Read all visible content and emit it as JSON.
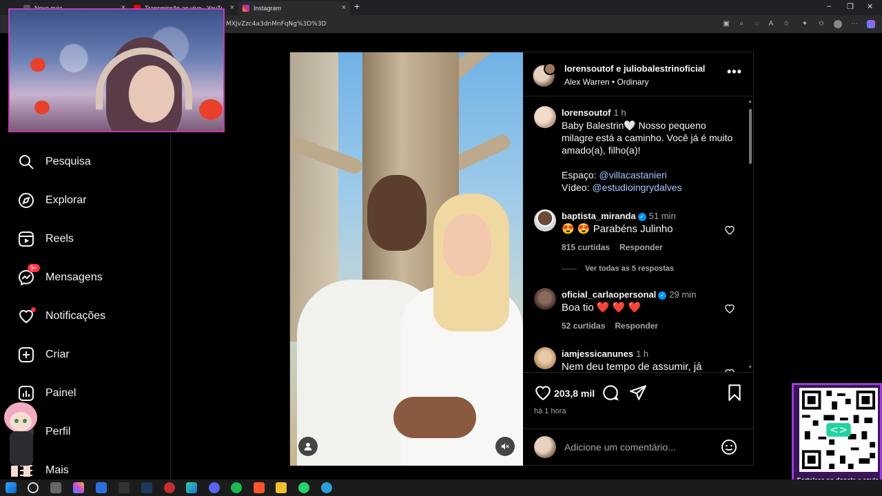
{
  "browser": {
    "tabs": [
      {
        "label": "Nova guia"
      },
      {
        "label": "Transmissão ao vivo - YouTube St"
      },
      {
        "label": "Instagram"
      }
    ],
    "url": "MXJvZzc4a3dnMnFqNg%3D%3D"
  },
  "sidebar": {
    "items": [
      {
        "label": "Pesquisa"
      },
      {
        "label": "Explorar"
      },
      {
        "label": "Reels"
      },
      {
        "label": "Mensagens",
        "badge": "9+"
      },
      {
        "label": "Notificações"
      },
      {
        "label": "Criar"
      },
      {
        "label": "Painel"
      },
      {
        "label": "Perfil"
      },
      {
        "label": "Mais"
      }
    ]
  },
  "post": {
    "header": {
      "users": "lorensoutof e juliobalestrinoficial",
      "audio": "Alex Warren • Ordinary"
    },
    "caption": {
      "user": "lorensoutof",
      "time": "1 h",
      "text": "Baby Balestrin🤍 Nosso pequeno milagre está a caminho. Você já é muito amado(a), filho(a)!",
      "space_label": "Espaço:",
      "space_link": "@villacastanieri",
      "video_label": "Vídeo:",
      "video_link": "@estudioingrydalves"
    },
    "comments": [
      {
        "user": "baptista_miranda",
        "time": "51 min",
        "text": "😍 😍 Parabéns Julinho",
        "likes": "815 curtidas",
        "reply": "Responder",
        "view_replies": "Ver todas as 5 respostas"
      },
      {
        "user": "oficial_carlaopersonal",
        "time": "29 min",
        "text": "Boa tio ❤️ ❤️ ❤️",
        "likes": "52 curtidas",
        "reply": "Responder"
      },
      {
        "user": "iamjessicanunes",
        "time": "1 h",
        "text": "Nem deu tempo de assumir, já"
      }
    ],
    "like_count": "203,8 mil",
    "posted": "há 1 hora",
    "add_comment_placeholder": "Adicione um comentário..."
  },
  "qr_overlay": {
    "text": "Fortaleça no donate e envie sua mensagem!"
  },
  "colors": {
    "background": "#000000",
    "accent_link": "#a5c8ff",
    "notification": "#ff3040",
    "verified": "#0095f6",
    "overlay_border": "#9b3fd6"
  }
}
